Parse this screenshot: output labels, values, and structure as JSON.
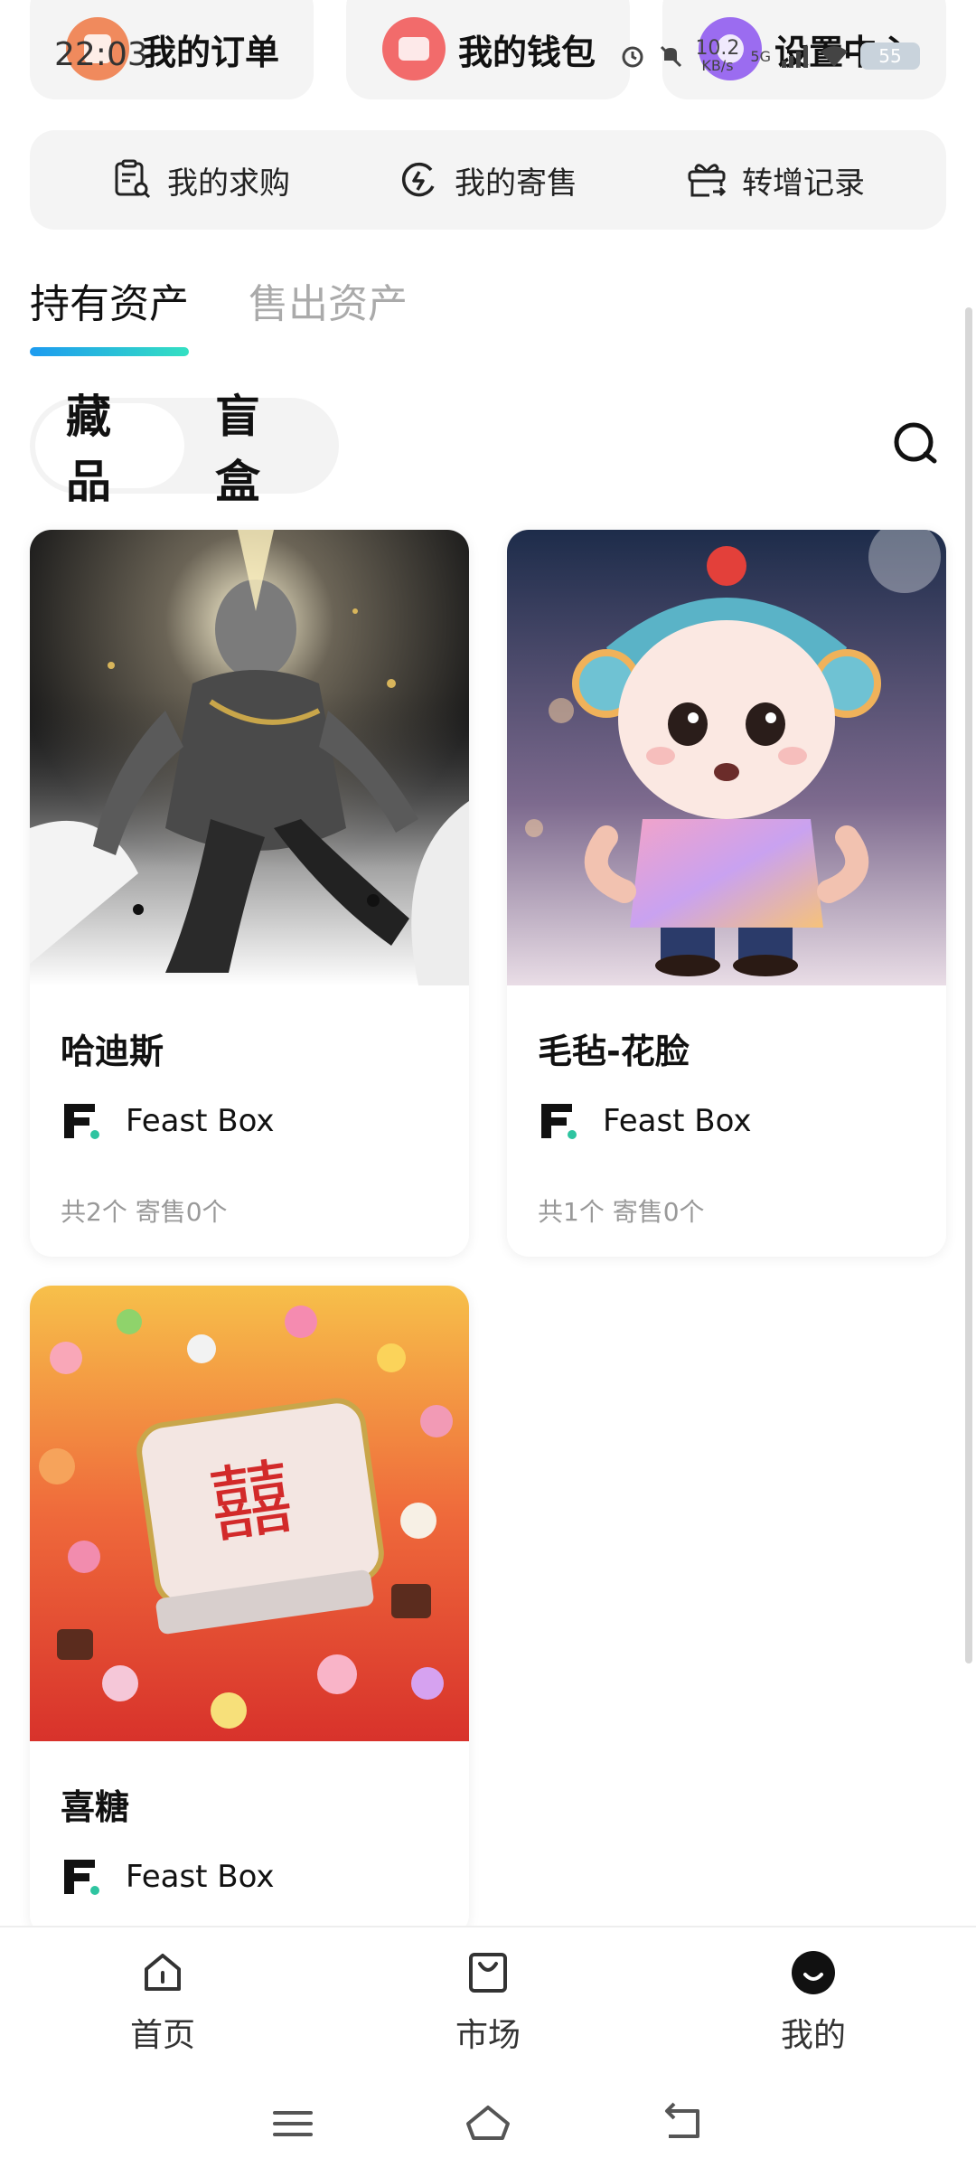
{
  "status_bar": {
    "time": "22:03",
    "net_speed": "10.2",
    "net_unit": "KB/s",
    "network_type": "5G",
    "battery": "55"
  },
  "quick_cards": [
    {
      "label": "我的订单",
      "icon": "order-icon",
      "color": "#f08a5d"
    },
    {
      "label": "我的钱包",
      "icon": "wallet-icon",
      "color": "#f26b6b"
    },
    {
      "label": "设置中心",
      "icon": "settings-icon",
      "color": "#9b6cf0"
    }
  ],
  "shortcuts": [
    {
      "label": "我的求购",
      "icon": "purchase-request-icon"
    },
    {
      "label": "我的寄售",
      "icon": "consignment-icon"
    },
    {
      "label": "转增记录",
      "icon": "gift-transfer-icon"
    }
  ],
  "asset_tabs": [
    {
      "label": "持有资产",
      "active": true
    },
    {
      "label": "售出资产",
      "active": false
    }
  ],
  "segment": [
    {
      "label": "藏品",
      "active": true
    },
    {
      "label": "盲盒",
      "active": false
    }
  ],
  "collectibles": [
    {
      "title": "哈迪斯",
      "brand": "Feast Box",
      "stats": "共2个 寄售0个"
    },
    {
      "title": "毛毡-花脸",
      "brand": "Feast Box",
      "stats": "共1个 寄售0个"
    },
    {
      "title": "喜糖",
      "brand": "Feast Box",
      "stats": "",
      "candy_glyph": "囍"
    }
  ],
  "bottom_nav": [
    {
      "label": "首页",
      "icon": "home-icon"
    },
    {
      "label": "市场",
      "icon": "market-bag-icon"
    },
    {
      "label": "我的",
      "icon": "profile-icon"
    }
  ],
  "colors": {
    "accent_gradient_start": "#1d9bf0",
    "accent_gradient_end": "#34e0c2",
    "brand_dot": "#2ec4a0"
  }
}
